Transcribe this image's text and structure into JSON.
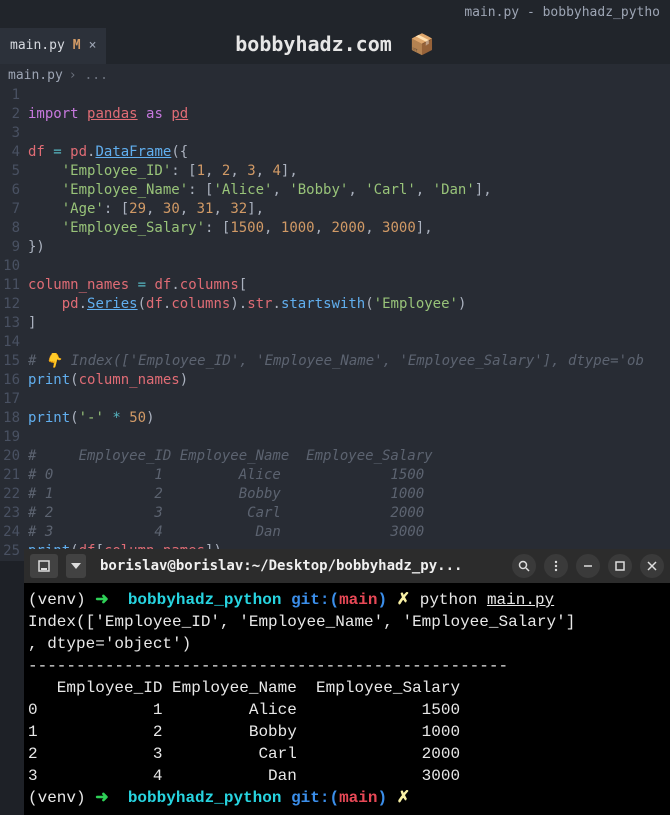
{
  "window": {
    "title": "main.py - bobbyhadz_pytho"
  },
  "tab": {
    "filename": "main.py",
    "modified_marker": "M",
    "close": "×"
  },
  "watermark": {
    "text": "bobbyhadz.com",
    "icon": "📦"
  },
  "breadcrumb": {
    "file": "main.py",
    "sep": "› ..."
  },
  "gutter_lines": [
    "1",
    "2",
    "3",
    "4",
    "5",
    "6",
    "7",
    "8",
    "9",
    "10",
    "11",
    "12",
    "13",
    "14",
    "15",
    "16",
    "17",
    "18",
    "19",
    "20",
    "21",
    "22",
    "23",
    "24",
    "25"
  ],
  "code": {
    "l1": {
      "kw1": "import",
      "mod": "pandas",
      "kw2": "as",
      "alias": "pd"
    },
    "l3": {
      "v": "df",
      "eq": "=",
      "p": "pd",
      "d": ".",
      "fn": "DataFrame",
      "op": "({"
    },
    "l4": {
      "k": "'Employee_ID'",
      "c": ": [",
      "n1": "1",
      "n2": "2",
      "n3": "3",
      "n4": "4",
      "e": "],"
    },
    "l5": {
      "k": "'Employee_Name'",
      "c": ": [",
      "s1": "'Alice'",
      "s2": "'Bobby'",
      "s3": "'Carl'",
      "s4": "'Dan'",
      "e": "],"
    },
    "l6": {
      "k": "'Age'",
      "c": ": [",
      "n1": "29",
      "n2": "30",
      "n3": "31",
      "n4": "32",
      "e": "],"
    },
    "l7": {
      "k": "'Employee_Salary'",
      "c": ": [",
      "n1": "1500",
      "n2": "1000",
      "n3": "2000",
      "n4": "3000",
      "e": "],"
    },
    "l8": {
      "c": "})"
    },
    "l10": {
      "v": "column_names",
      "eq": "=",
      "df": "df",
      "d": ".",
      "col": "columns",
      "br": "["
    },
    "l11": {
      "p": "pd",
      "d": ".",
      "fn": "Series",
      "o": "(",
      "df": "df",
      "col": "columns",
      "cb": ").",
      "str": "str",
      "d2": ".",
      "sw": "startswith",
      "ob": "(",
      "arg": "'Employee'",
      "cb2": ")"
    },
    "l12": {
      "br": "]"
    },
    "l14": {
      "t": "# 👇️ Index(['Employee_ID', 'Employee_Name', 'Employee_Salary'], dtype='ob"
    },
    "l15": {
      "fn": "print",
      "o": "(",
      "v": "column_names",
      "c": ")"
    },
    "l17": {
      "fn": "print",
      "o": "(",
      "s": "'-'",
      "op": "*",
      "n": "50",
      "c": ")"
    },
    "l19": {
      "t": "#     Employee_ID Employee_Name  Employee_Salary"
    },
    "l20": {
      "t": "# 0            1         Alice             1500"
    },
    "l21": {
      "t": "# 1            2         Bobby             1000"
    },
    "l22": {
      "t": "# 2            3          Carl             2000"
    },
    "l23": {
      "t": "# 3            4           Dan             3000"
    },
    "l24": {
      "fn": "print",
      "o": "(",
      "df": "df",
      "ob": "[",
      "v": "column_names",
      "cb": "])"
    }
  },
  "terminal": {
    "title": "borislav@borislav:~/Desktop/bobbyhadz_py...",
    "prompt1": {
      "venv": "(venv)",
      "arrow": "➜",
      "dir": "bobbyhadz_python",
      "git": "git:(",
      "branch": "main",
      "gitc": ")",
      "dirty": "✗",
      "cmd": "python",
      "file": "main.py"
    },
    "out1": "Index(['Employee_ID', 'Employee_Name', 'Employee_Salary']",
    "out2": ", dtype='object')",
    "out3": "--------------------------------------------------",
    "out4": "   Employee_ID Employee_Name  Employee_Salary",
    "out5": "0            1         Alice             1500",
    "out6": "1            2         Bobby             1000",
    "out7": "2            3          Carl             2000",
    "out8": "3            4           Dan             3000",
    "prompt2": {
      "venv": "(venv)",
      "arrow": "➜",
      "dir": "bobbyhadz_python",
      "git": "git:(",
      "branch": "main",
      "gitc": ")",
      "dirty": "✗"
    }
  }
}
